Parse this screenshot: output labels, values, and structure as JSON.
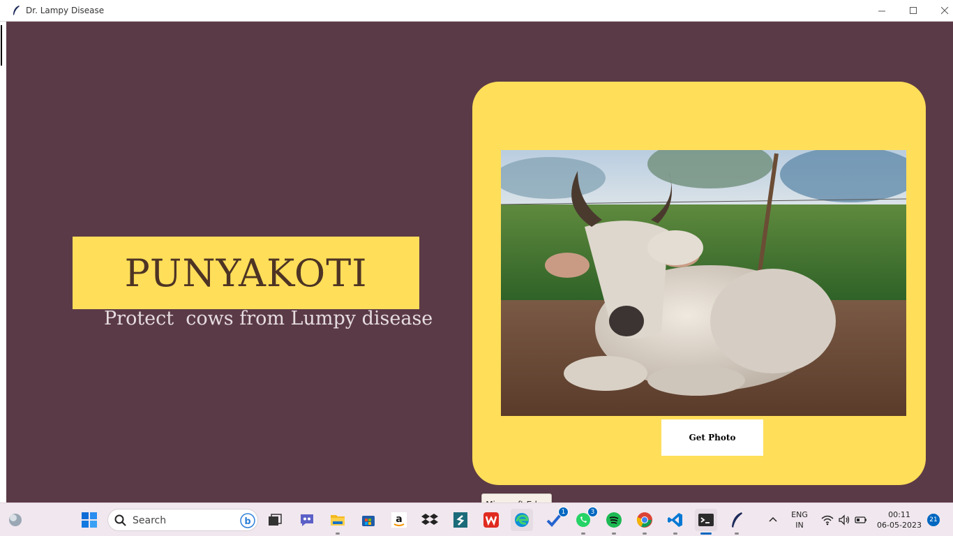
{
  "window": {
    "title": "Dr. Lampy Disease",
    "minimize_icon": "minimize-icon",
    "maximize_icon": "maximize-icon",
    "close_icon": "close-icon"
  },
  "hero": {
    "brand": "PUNYAKOTI",
    "tagline": "Protect  cows from Lumpy disease",
    "brand_box_color": "#ffde59",
    "background_color": "#5b3a47"
  },
  "card": {
    "photo_alt": "cow-photo",
    "button_label": "Get Photo"
  },
  "tooltip": {
    "text": "Microsoft Edge"
  },
  "taskbar": {
    "search_placeholder": "Search",
    "apps": [
      {
        "name": "widgets",
        "icon": "weather-icon"
      },
      {
        "name": "start",
        "icon": "windows-start-icon"
      },
      {
        "name": "task-view",
        "icon": "task-view-icon"
      },
      {
        "name": "chat",
        "icon": "teams-chat-icon"
      },
      {
        "name": "file-explorer",
        "icon": "folder-icon"
      },
      {
        "name": "store",
        "icon": "store-icon"
      },
      {
        "name": "amazon",
        "icon": "amazon-icon"
      },
      {
        "name": "dropbox",
        "icon": "dropbox-icon"
      },
      {
        "name": "app-s",
        "icon": "s-app-icon"
      },
      {
        "name": "wps",
        "icon": "wps-office-icon"
      },
      {
        "name": "edge",
        "icon": "edge-icon"
      },
      {
        "name": "todo",
        "icon": "todo-icon",
        "badge": "1"
      },
      {
        "name": "whatsapp",
        "icon": "whatsapp-icon",
        "badge": "3"
      },
      {
        "name": "spotify",
        "icon": "spotify-icon"
      },
      {
        "name": "chrome",
        "icon": "chrome-icon"
      },
      {
        "name": "vscode",
        "icon": "vscode-icon"
      },
      {
        "name": "terminal",
        "icon": "terminal-icon"
      },
      {
        "name": "feather-app",
        "icon": "feather-icon"
      }
    ],
    "tray": {
      "lang_top": "ENG",
      "lang_bottom": "IN",
      "time": "00:11",
      "date": "06-05-2023",
      "notifications": "21"
    }
  }
}
